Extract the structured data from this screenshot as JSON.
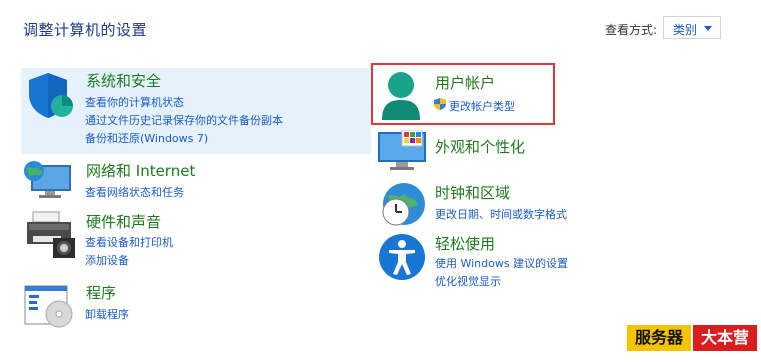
{
  "header": {
    "title": "调整计算机的设置"
  },
  "viewby": {
    "label": "查看方式:",
    "value": "类别"
  },
  "left": {
    "system": {
      "title": "系统和安全",
      "links": [
        "查看你的计算机状态",
        "通过文件历史记录保存你的文件备份副本",
        "备份和还原(Windows 7)"
      ]
    },
    "network": {
      "title": "网络和 Internet",
      "links": [
        "查看网络状态和任务"
      ]
    },
    "hardware": {
      "title": "硬件和声音",
      "links": [
        "查看设备和打印机",
        "添加设备"
      ]
    },
    "programs": {
      "title": "程序",
      "links": [
        "卸载程序"
      ]
    }
  },
  "right": {
    "accounts": {
      "title": "用户帐户",
      "links": [
        "更改帐户类型"
      ]
    },
    "appearance": {
      "title": "外观和个性化"
    },
    "clock": {
      "title": "时钟和区域",
      "links": [
        "更改日期、时间或数字格式"
      ]
    },
    "ease": {
      "title": "轻松使用",
      "links": [
        "使用 Windows 建议的设置",
        "优化视觉显示"
      ]
    }
  },
  "watermark": {
    "part1": "服务器",
    "part2": "大本营"
  },
  "colors": {
    "link": "#1a5ccf",
    "category_title": "#1f7a1f",
    "highlight": "#e5f1fb",
    "callout": "#e0373a"
  }
}
